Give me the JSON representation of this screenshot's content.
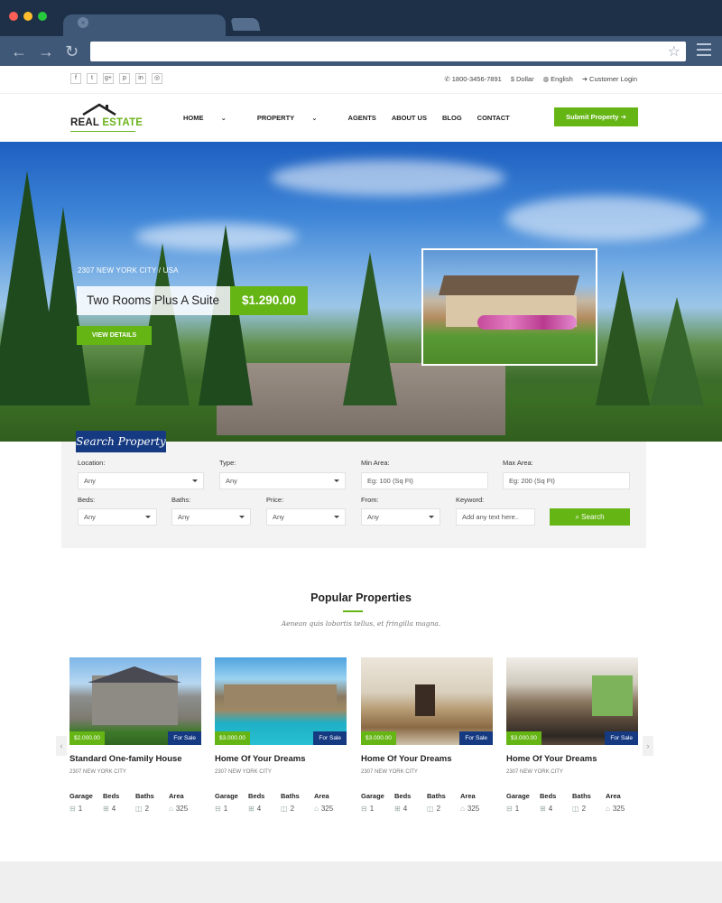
{
  "browser": {
    "tab_close": "×",
    "back": "←",
    "forward": "→",
    "reload": "↻",
    "star": "☆",
    "colors": {
      "red": "#ff5f56",
      "yellow": "#ffbd2e",
      "green": "#27c93f"
    }
  },
  "topbar": {
    "social": [
      "f",
      "t",
      "g+",
      "p",
      "in",
      "◎"
    ],
    "phone": "1800-3456-7891",
    "currency": "Dollar",
    "language": "English",
    "login": "Customer Login"
  },
  "header": {
    "logo_real": "REAL",
    "logo_estate": "ESTATE",
    "nav": [
      "HOME",
      "PROPERTY",
      "AGENTS",
      "ABOUT US",
      "BLOG",
      "CONTACT"
    ],
    "submit": "Submit Property"
  },
  "hero": {
    "location": "2307 NEW YORK CITY / USA",
    "title": "Two Rooms Plus A Suite",
    "price": "$1.290.00",
    "button": "VIEW DETAILS"
  },
  "search": {
    "tab": "Search Property",
    "location_label": "Location:",
    "location_value": "Any",
    "type_label": "Type:",
    "type_value": "Any",
    "min_area_label": "Min Area:",
    "min_area_placeholder": "Eg: 100 (Sq Ft)",
    "max_area_label": "Max Area:",
    "max_area_placeholder": "Eg: 200 (Sq Ft)",
    "beds_label": "Beds:",
    "beds_value": "Any",
    "baths_label": "Baths:",
    "baths_value": "Any",
    "price_label": "Price:",
    "price_value": "Any",
    "from_label": "From:",
    "from_value": "Any",
    "keyword_label": "Keyword:",
    "keyword_placeholder": "Add any text here..",
    "button": "Search"
  },
  "popular": {
    "title": "Popular Properties",
    "subtitle": "Aenean quis lobortis tellus, et fringilla magna.",
    "prev": "‹",
    "next": "›",
    "feature_labels": [
      "Garage",
      "Beds",
      "Baths",
      "Area"
    ],
    "cards": [
      {
        "price": "$2.000.00",
        "status": "For Sale",
        "title": "Standard One-family House",
        "location": "2307 NEW YORK CITY",
        "garage": "1",
        "beds": "4",
        "baths": "2",
        "area": "325"
      },
      {
        "price": "$3.000.00",
        "status": "For Sale",
        "title": "Home Of Your Dreams",
        "location": "2307 NEW YORK CITY",
        "garage": "1",
        "beds": "4",
        "baths": "2",
        "area": "325"
      },
      {
        "price": "$3.000.00",
        "status": "For Sale",
        "title": "Home Of Your Dreams",
        "location": "2307 NEW YORK CITY",
        "garage": "1",
        "beds": "4",
        "baths": "2",
        "area": "325"
      },
      {
        "price": "$3.000.00",
        "status": "For Sale",
        "title": "Home Of Your Dreams",
        "location": "2307 NEW YORK CITY",
        "garage": "1",
        "beds": "4",
        "baths": "2",
        "area": "325"
      }
    ]
  },
  "colors": {
    "accent": "#65b515",
    "brand_blue": "#163a82"
  }
}
